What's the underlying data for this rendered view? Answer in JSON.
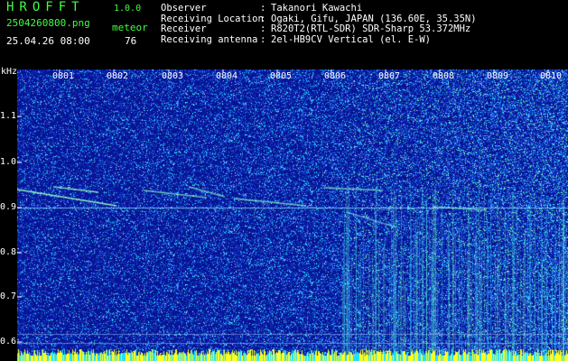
{
  "app": {
    "name": "HROFFT",
    "version": "1.0.0"
  },
  "capture": {
    "file_name": "2504260800.png",
    "date_time": "25.04.26 08:00",
    "meteor_label": "meteor",
    "meteor_count": "76"
  },
  "info": [
    {
      "label": "Observer",
      "value": "Takanori Kawachi"
    },
    {
      "label": "Receiving Location",
      "value": "Ogaki, Gifu, JAPAN (136.60E, 35.35N)"
    },
    {
      "label": "Receiver",
      "value": "R820T2(RTL-SDR) SDR-Sharp 53.372MHz"
    },
    {
      "label": "Receiving antenna",
      "value": "2el-HB9CV Vertical (el. E-W)"
    }
  ],
  "axis": {
    "unit": "kHz",
    "y_labels": [
      "1.1",
      "1.0",
      "0.9",
      "0.8",
      "0.7",
      "0.6"
    ],
    "x_labels": [
      "0801",
      "0802",
      "0803",
      "0804",
      "0805",
      "0806",
      "0807",
      "0808",
      "0809",
      "0810"
    ]
  },
  "colors": {
    "background": "#000000",
    "header_green": "#40ff40",
    "header_white": "#ffffff",
    "noise_low": "#0a1a9a",
    "noise_mid": "#2a5cff",
    "noise_high": "#30e0ff",
    "baseline_yellow": "#ffff20"
  }
}
